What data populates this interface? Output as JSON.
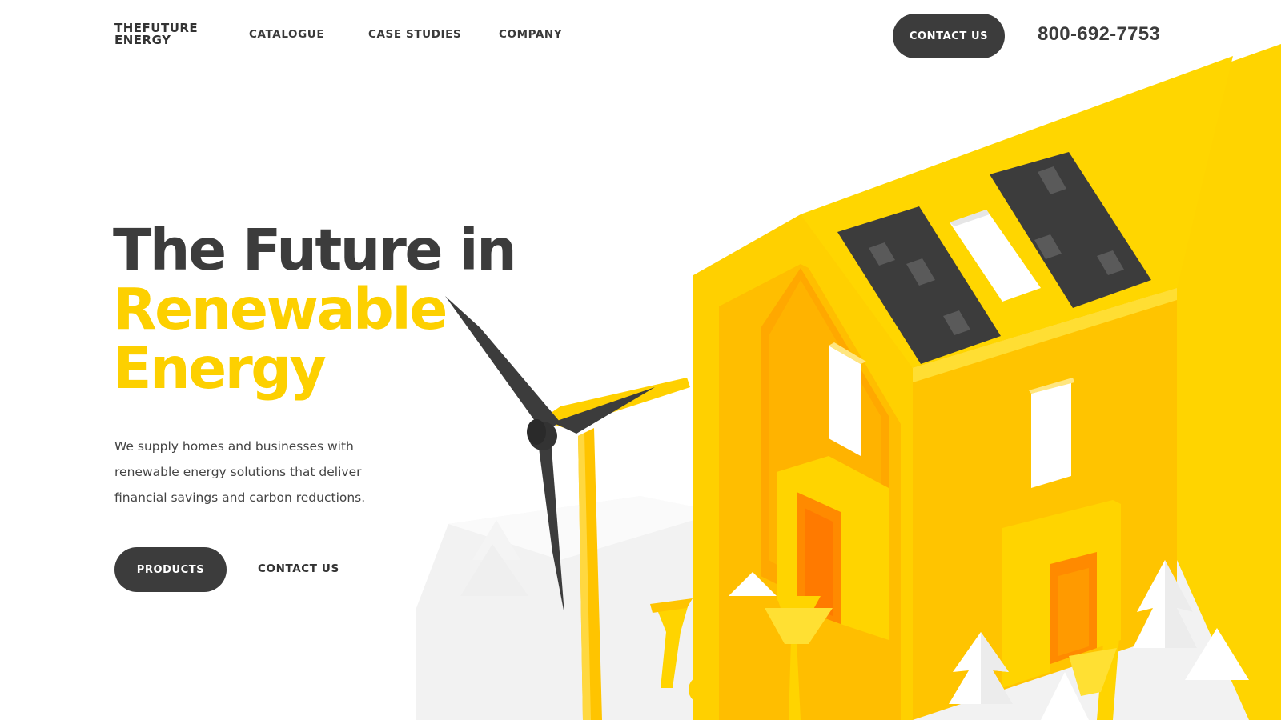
{
  "header": {
    "logo_line1": "THEFUTURE",
    "logo_line2": "ENERGY",
    "nav": [
      "CATALOGUE",
      "CASE STUDIES",
      "COMPANY"
    ],
    "contact_button": "CONTACT US",
    "phone": "800-692-7753"
  },
  "hero": {
    "title_line1": "The Future in",
    "title_line2": "Renewable",
    "title_line3": "Energy",
    "description_lines": [
      "We supply homes and businesses with",
      "renewable energy solutions that deliver",
      "financial savings and carbon reductions."
    ],
    "primary_button": "PRODUCTS",
    "secondary_link": "CONTACT US"
  },
  "colors": {
    "accent_yellow": "#fdd000",
    "dark_gray": "#3c3c3c",
    "orange_shade": "#ff9a00"
  },
  "illustration": {
    "icons": [
      "wind-turbine-icon",
      "house-icon",
      "solar-panel-icon",
      "tree-icon"
    ]
  }
}
